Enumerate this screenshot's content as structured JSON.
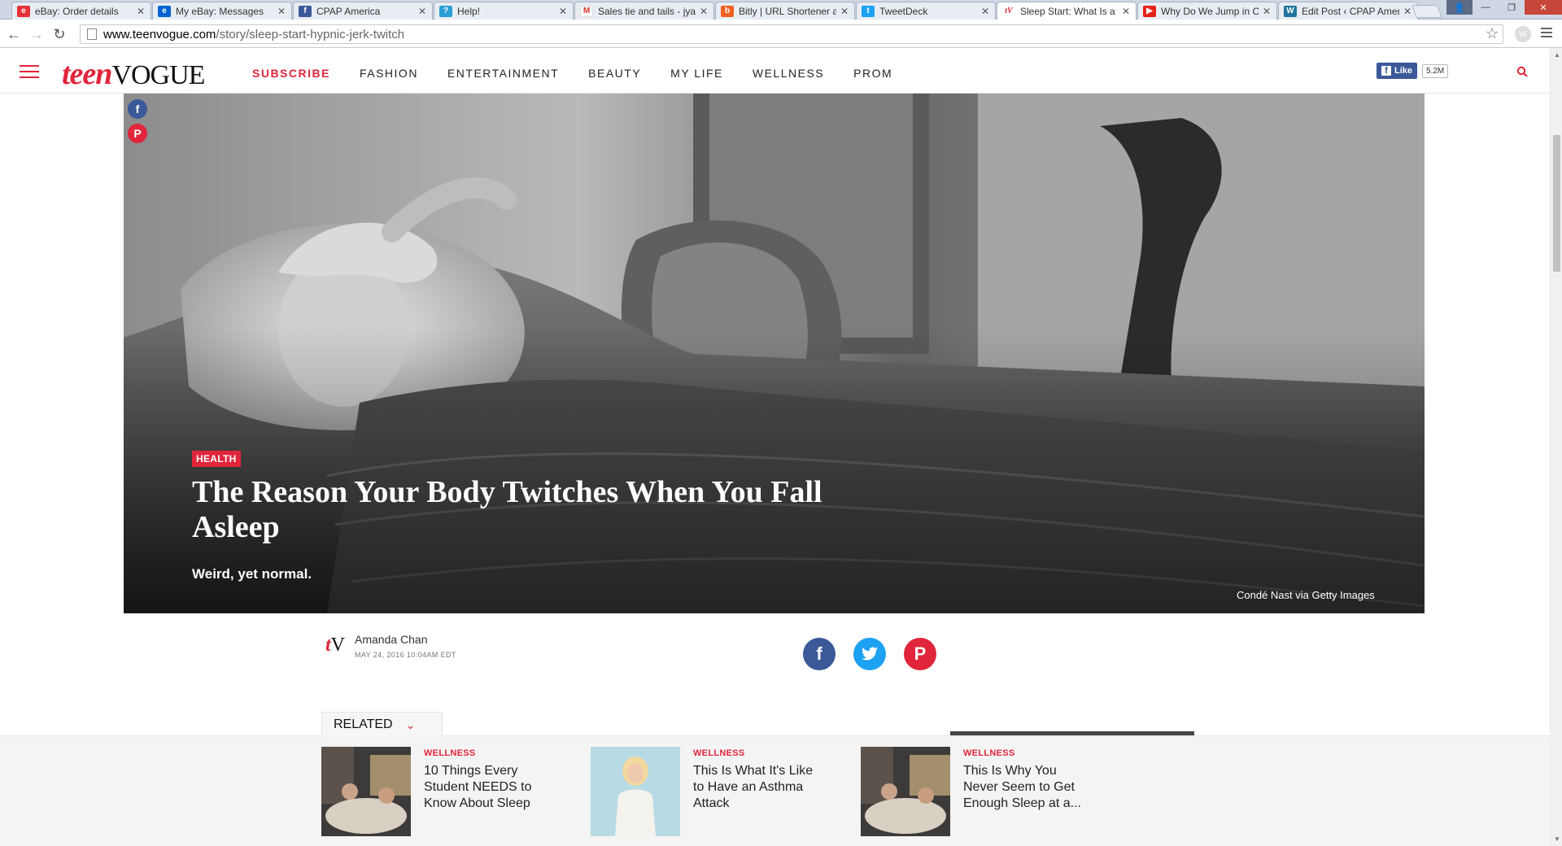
{
  "browser": {
    "tabs": [
      {
        "label": "eBay: Order details",
        "favicon": "ebay-icon",
        "color": "#e53238",
        "active": false
      },
      {
        "label": "My eBay: Messages",
        "favicon": "ebay-messages-icon",
        "color": "#0064d2",
        "active": false
      },
      {
        "label": "CPAP America",
        "favicon": "facebook-icon",
        "color": "#3b5998",
        "active": false
      },
      {
        "label": "Help!",
        "favicon": "help-icon",
        "color": "#2a9fd6",
        "active": false
      },
      {
        "label": "Sales tie and tails - jya",
        "favicon": "gmail-icon",
        "color": "#d93025",
        "active": false
      },
      {
        "label": "Bitly | URL Shortener a",
        "favicon": "bitly-icon",
        "color": "#ee6123",
        "active": false
      },
      {
        "label": "TweetDeck",
        "favicon": "tweetdeck-icon",
        "color": "#1da1f2",
        "active": false
      },
      {
        "label": "Sleep Start: What Is a",
        "favicon": "teenvogue-icon",
        "color": "#e1253b",
        "active": true
      },
      {
        "label": "Why Do We Jump in C",
        "favicon": "youtube-icon",
        "color": "#e62117",
        "active": false
      },
      {
        "label": "Edit Post ‹ CPAP Amer",
        "favicon": "wordpress-icon",
        "color": "#21759b",
        "active": false
      }
    ],
    "url_host": "www.teenvogue.com",
    "url_path": "/story/sleep-start-hypnic-jerk-twitch"
  },
  "site": {
    "logo_teen": "teen",
    "logo_vogue": "VOGUE",
    "nav": [
      "SUBSCRIBE",
      "FASHION",
      "ENTERTAINMENT",
      "BEAUTY",
      "MY LIFE",
      "WELLNESS",
      "PROM"
    ],
    "fb_like_label": "Like",
    "fb_like_count": "5.2M",
    "accent_color": "#e1253b"
  },
  "article": {
    "category": "HEALTH",
    "headline": "The Reason Your Body Twitches When You Fall Asleep",
    "dek": "Weird, yet normal.",
    "photo_credit": "Condé Nast via Getty Images",
    "author": "Amanda Chan",
    "date": "MAY 24, 2016 10:04AM EDT",
    "byline_logo_t": "t",
    "byline_logo_v": "V",
    "social_icons": [
      "facebook-icon",
      "twitter-icon",
      "pinterest-icon"
    ]
  },
  "related": {
    "tab_label": "RELATED",
    "items": [
      {
        "category": "WELLNESS",
        "title": "10 Things Every Student NEEDS to Know About Sleep"
      },
      {
        "category": "WELLNESS",
        "title": "This Is What It's Like to Have an Asthma Attack"
      },
      {
        "category": "WELLNESS",
        "title": "This Is Why You Never Seem to Get Enough Sleep at a..."
      }
    ]
  }
}
